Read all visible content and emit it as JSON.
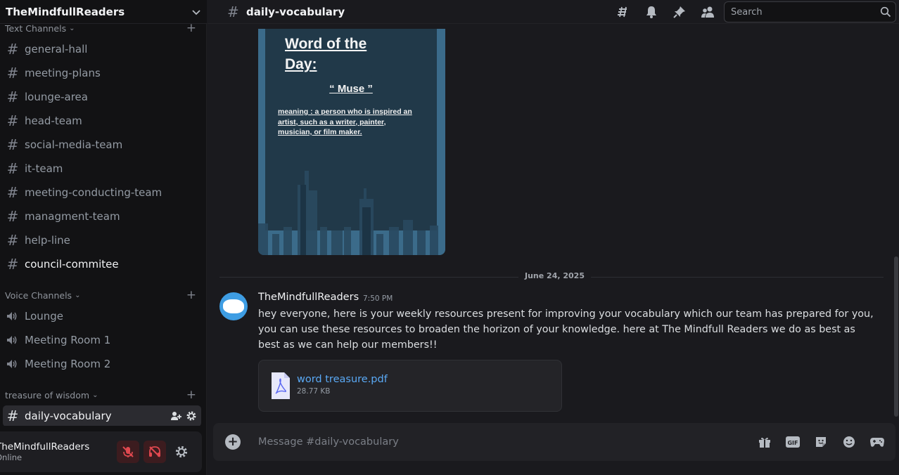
{
  "server": {
    "name": "TheMindfullReaders"
  },
  "categories": {
    "text": "Text Channels",
    "voice": "Voice Channels",
    "treasure": "treasure of wisdom"
  },
  "text_channels": [
    {
      "label": "general-hall"
    },
    {
      "label": "meeting-plans"
    },
    {
      "label": "lounge-area"
    },
    {
      "label": "head-team"
    },
    {
      "label": "social-media-team"
    },
    {
      "label": "it-team"
    },
    {
      "label": "meeting-conducting-team"
    },
    {
      "label": "managment-team"
    },
    {
      "label": "help-line"
    },
    {
      "label": "council-commitee"
    }
  ],
  "voice_channels": [
    {
      "label": "Lounge"
    },
    {
      "label": "Meeting Room 1"
    },
    {
      "label": "Meeting Room 2"
    }
  ],
  "treasure_channels": [
    {
      "label": "daily-vocabulary"
    }
  ],
  "user_panel": {
    "name": "TheMindfullReaders",
    "status": "Online"
  },
  "topbar": {
    "channel": "daily-vocabulary",
    "search_placeholder": "Search"
  },
  "poster": {
    "title": "Word of the Day:",
    "word": "“ Muse ”",
    "meaning": "meaning : a person who is inspired an artist, such as a writer, painter, musician, or film maker."
  },
  "date_divider": "June 24, 2025",
  "message": {
    "author": "TheMindfullReaders",
    "time": "7:50 PM",
    "text": "hey everyone, here is your  weekly resources present for improving your vocabulary which our team has prepared for you, you can use these resources to broaden the horizon of your knowledge. here at The Mindfull Readers we do as best as best as we can help our members!!",
    "attachment": {
      "name": "word treasure.pdf",
      "size": "28.77 KB"
    }
  },
  "composer": {
    "placeholder": "Message #daily-vocabulary",
    "gif_label": "GIF"
  },
  "colors": {
    "accent": "#5aa9f5",
    "sidebar": "#121214",
    "main": "#1a1a1e",
    "muted_red": "#e0484f"
  }
}
